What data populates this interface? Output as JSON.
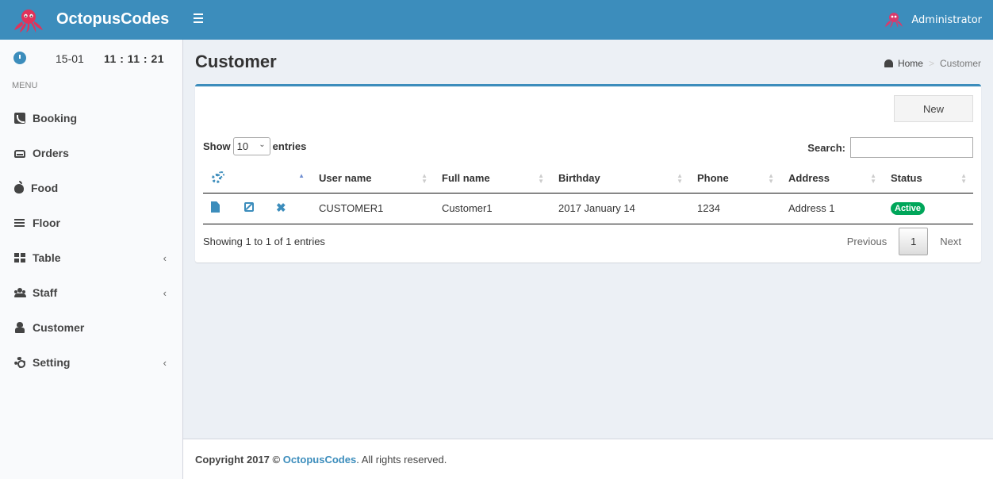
{
  "brand": {
    "name": "OctopusCodes",
    "logo_icon": "octopus-logo-icon"
  },
  "header": {
    "user_name": "Administrator",
    "menu_icon": "hamburger-icon"
  },
  "sidebar": {
    "clock": {
      "date": "15-01",
      "time": "11 : 11 : 21"
    },
    "menu_header": "MENU",
    "items": [
      {
        "label": "Booking",
        "icon": "phone-icon",
        "has_children": false
      },
      {
        "label": "Orders",
        "icon": "inbox-icon",
        "has_children": false
      },
      {
        "label": "Food",
        "icon": "apple-icon",
        "has_children": false
      },
      {
        "label": "Floor",
        "icon": "bars-icon",
        "has_children": false
      },
      {
        "label": "Table",
        "icon": "grid-icon",
        "has_children": true
      },
      {
        "label": "Staff",
        "icon": "users-icon",
        "has_children": true
      },
      {
        "label": "Customer",
        "icon": "user-icon",
        "has_children": false
      },
      {
        "label": "Setting",
        "icon": "gear-icon",
        "has_children": true
      }
    ],
    "chevron": "‹"
  },
  "page": {
    "title": "Customer",
    "breadcrumb": {
      "home": "Home",
      "current": "Customer"
    }
  },
  "box": {
    "new_button": "New",
    "show_label": "Show",
    "entries_value": "10",
    "entries_label": "entries",
    "search_label": "Search:",
    "search_value": "",
    "columns": [
      "User name",
      "Full name",
      "Birthday",
      "Phone",
      "Address",
      "Status"
    ],
    "rows": [
      {
        "username": "CUSTOMER1",
        "fullname": "Customer1",
        "birthday": "2017 January 14",
        "phone": "1234",
        "address": "Address 1",
        "status": "Active"
      }
    ],
    "info": "Showing 1 to 1 of 1 entries",
    "pagination": {
      "previous": "Previous",
      "current": "1",
      "next": "Next"
    }
  },
  "footer": {
    "prefix": "Copyright 2017 © ",
    "brand": "OctopusCodes",
    "suffix": ". All rights reserved."
  },
  "colors": {
    "primary": "#3c8dbc",
    "success": "#00a65a",
    "body_bg": "#ecf0f5",
    "sidebar_bg": "#f9fafc"
  }
}
